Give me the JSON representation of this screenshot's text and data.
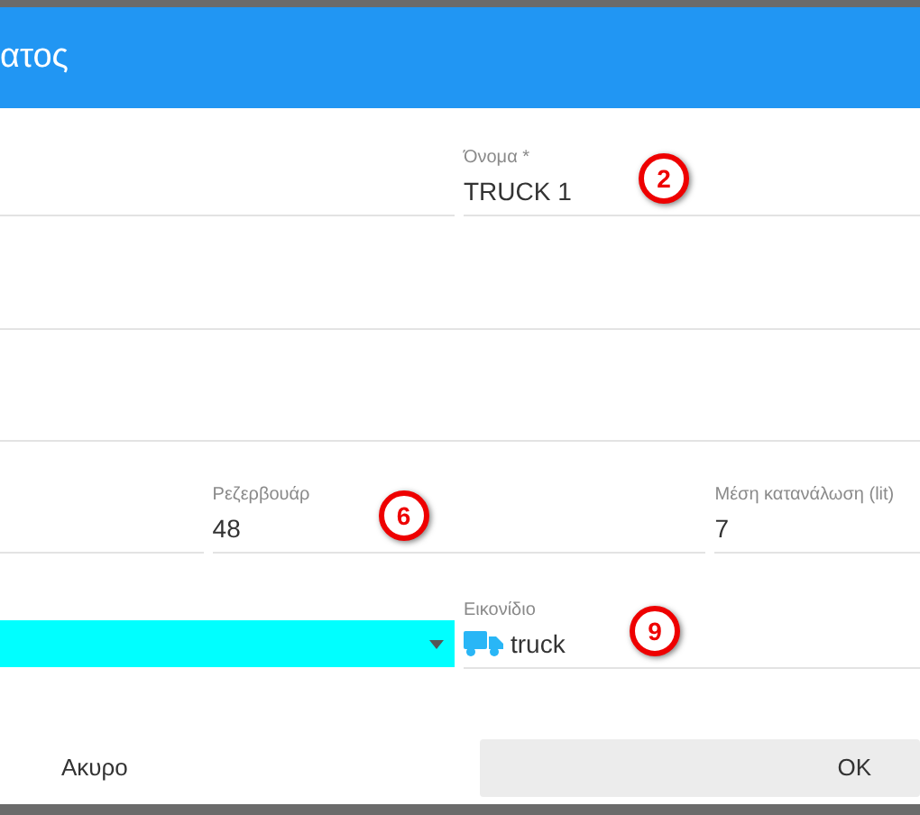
{
  "dialog": {
    "title": "ατος"
  },
  "rows": [
    [
      {
        "kind": "text"
      },
      {
        "kind": "text",
        "label": "Όνομα *",
        "value": "TRUCK 1",
        "callout": "2"
      }
    ],
    [
      {
        "kind": "text"
      }
    ],
    [
      {
        "kind": "text"
      }
    ],
    [
      {
        "kind": "text"
      },
      {
        "kind": "text",
        "label": "Ρεζερβουάρ",
        "value": "48",
        "callout": "6"
      },
      {
        "kind": "text",
        "label": "Μέση κατανάλωση (lit)",
        "value": "7"
      }
    ],
    [
      {
        "kind": "color",
        "color": "#00ffff"
      },
      {
        "kind": "icon",
        "label": "Εικονίδιο",
        "value": "truck",
        "callout": "9"
      }
    ]
  ],
  "buttons": [
    {
      "label": "Ακυρο",
      "kind": "flat"
    },
    {
      "label": "OK",
      "kind": "raised"
    }
  ]
}
